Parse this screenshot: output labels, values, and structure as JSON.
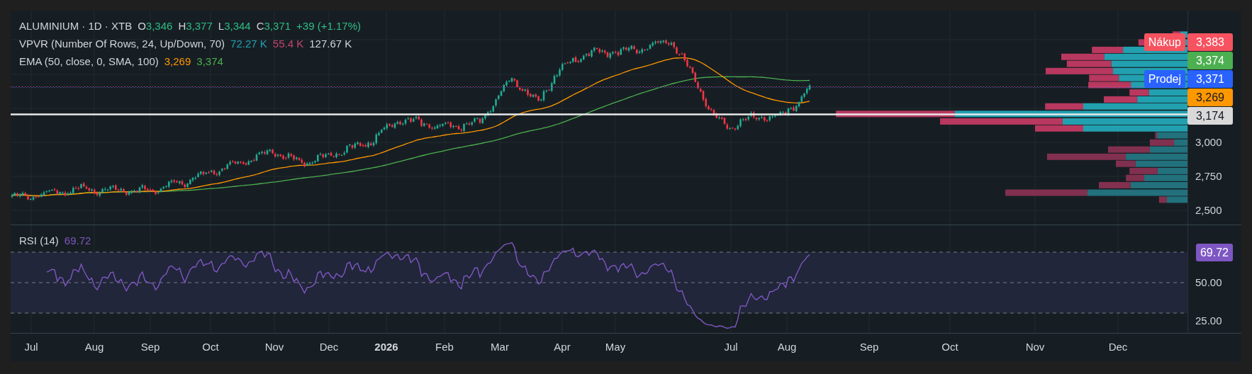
{
  "legend": [
    {
      "title": "ALUMINIUM · 1D · XTB",
      "values": [
        {
          "label": "O",
          "value": "3,346",
          "color": "#2ebd85"
        },
        {
          "label": "H",
          "value": "3,377",
          "color": "#2ebd85"
        },
        {
          "label": "L",
          "value": "3,344",
          "color": "#2ebd85"
        },
        {
          "label": "C",
          "value": "3,371",
          "color": "#2ebd85"
        },
        {
          "value": "+39 (+1.17%)",
          "color": "#2ebd85"
        }
      ]
    },
    {
      "title": "VPVR (Number Of Rows, 24, Up/Down, 70)",
      "values": [
        {
          "value": "72.27 K",
          "color": "#22a1b5"
        },
        {
          "value": "55.4 K",
          "color": "#c2456e"
        },
        {
          "value": "127.67 K",
          "color": "#d1d4dc"
        }
      ]
    },
    {
      "title": "EMA (50, close, 0, SMA, 100)",
      "values": [
        {
          "value": "3,269",
          "color": "#ff9800"
        },
        {
          "value": "3,374",
          "color": "#4caf50"
        }
      ]
    }
  ],
  "price_axis": {
    "ticks": [
      "3,000",
      "2,750",
      "2,500"
    ]
  },
  "price_tags": [
    {
      "label": "Nákup",
      "value": "3,383",
      "color": "#f7525f"
    },
    {
      "value": "3,374",
      "color": "#4caf50"
    },
    {
      "label": "Prodej",
      "value": "3,371",
      "color": "#2962ff"
    },
    {
      "value": "3,269",
      "color": "#ff9800"
    },
    {
      "value": "3,174",
      "color": "#d9d9d9"
    }
  ],
  "rsi": {
    "title": "RSI (14)",
    "value": "69.72",
    "ticks": [
      "50.00",
      "25.00"
    ],
    "tag": {
      "value": "69.72",
      "color": "#7e57c2"
    }
  },
  "time_axis": [
    {
      "text": "Jul",
      "kind": "month"
    },
    {
      "text": "Aug",
      "kind": "month"
    },
    {
      "text": "Sep",
      "kind": "month"
    },
    {
      "text": "Oct",
      "kind": "month"
    },
    {
      "text": "Nov",
      "kind": "month"
    },
    {
      "text": "Dec",
      "kind": "month"
    },
    {
      "text": "2026",
      "kind": "year"
    },
    {
      "text": "Feb",
      "kind": "month"
    },
    {
      "text": "Mar",
      "kind": "month"
    },
    {
      "text": "Apr",
      "kind": "month"
    },
    {
      "text": "May",
      "kind": "month"
    },
    {
      "text": "Jul",
      "kind": "month"
    },
    {
      "text": "Aug",
      "kind": "month"
    },
    {
      "text": "Sep",
      "kind": "month"
    },
    {
      "text": "Oct",
      "kind": "month"
    },
    {
      "text": "Nov",
      "kind": "month"
    },
    {
      "text": "Dec",
      "kind": "month"
    }
  ]
}
